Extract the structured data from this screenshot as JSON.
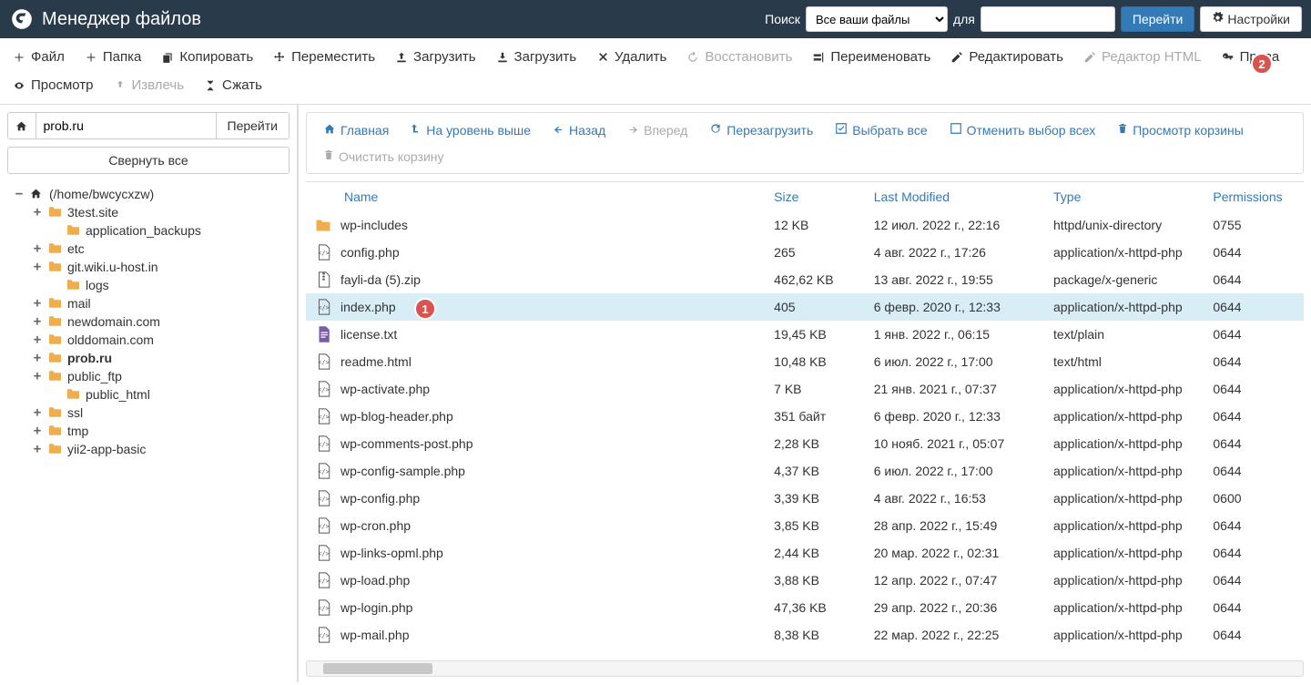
{
  "header": {
    "title": "Менеджер файлов",
    "search_label": "Поиск",
    "for_label": "для",
    "go_btn": "Перейти",
    "settings_btn": "Настройки",
    "search_scope": "Все ваши файлы"
  },
  "toolbar": [
    {
      "id": "file",
      "label": "Файл",
      "icon": "plus",
      "disabled": false
    },
    {
      "id": "folder",
      "label": "Папка",
      "icon": "plus",
      "disabled": false
    },
    {
      "id": "copy",
      "label": "Копировать",
      "icon": "copy",
      "disabled": false
    },
    {
      "id": "move",
      "label": "Переместить",
      "icon": "move",
      "disabled": false
    },
    {
      "id": "upload",
      "label": "Загрузить",
      "icon": "upload",
      "disabled": false
    },
    {
      "id": "download",
      "label": "Загрузить",
      "icon": "download",
      "disabled": false
    },
    {
      "id": "delete",
      "label": "Удалить",
      "icon": "delete",
      "disabled": false
    },
    {
      "id": "restore",
      "label": "Восстановить",
      "icon": "restore",
      "disabled": true
    },
    {
      "id": "rename",
      "label": "Переименовать",
      "icon": "rename",
      "disabled": false
    },
    {
      "id": "edit",
      "label": "Редактировать",
      "icon": "edit",
      "disabled": false
    },
    {
      "id": "htmleditor",
      "label": "Редактор HTML",
      "icon": "html",
      "disabled": true
    },
    {
      "id": "perms",
      "label": "Права",
      "icon": "key",
      "disabled": false
    },
    {
      "id": "view",
      "label": "Просмотр",
      "icon": "eye",
      "disabled": false
    },
    {
      "id": "extract",
      "label": "Извлечь",
      "icon": "extract",
      "disabled": true
    },
    {
      "id": "compress",
      "label": "Сжать",
      "icon": "compress",
      "disabled": false
    }
  ],
  "sidebar": {
    "path_value": "prob.ru",
    "go_btn": "Перейти",
    "collapse_btn": "Свернуть все",
    "root_label": "(/home/bwcycxzw)",
    "tree": [
      {
        "label": "3test.site",
        "exp": "+",
        "children": [
          {
            "label": "application_backups",
            "exp": ""
          }
        ]
      },
      {
        "label": "etc",
        "exp": "+"
      },
      {
        "label": "git.wiki.u-host.in",
        "exp": "+",
        "children": [
          {
            "label": "logs",
            "exp": ""
          }
        ]
      },
      {
        "label": "mail",
        "exp": "+"
      },
      {
        "label": "newdomain.com",
        "exp": "+"
      },
      {
        "label": "olddomain.com",
        "exp": "+"
      },
      {
        "label": "prob.ru",
        "exp": "+",
        "bold": true
      },
      {
        "label": "public_ftp",
        "exp": "+",
        "children": [
          {
            "label": "public_html",
            "exp": ""
          }
        ]
      },
      {
        "label": "ssl",
        "exp": "+"
      },
      {
        "label": "tmp",
        "exp": "+"
      },
      {
        "label": "yii2-app-basic",
        "exp": "+"
      }
    ]
  },
  "nav": [
    {
      "id": "home",
      "label": "Главная",
      "icon": "home",
      "disabled": false
    },
    {
      "id": "up",
      "label": "На уровень выше",
      "icon": "levelup",
      "disabled": false
    },
    {
      "id": "back",
      "label": "Назад",
      "icon": "back",
      "disabled": false
    },
    {
      "id": "forward",
      "label": "Вперед",
      "icon": "forward",
      "disabled": true
    },
    {
      "id": "reload",
      "label": "Перезагрузить",
      "icon": "reload",
      "disabled": false
    },
    {
      "id": "selectall",
      "label": "Выбрать все",
      "icon": "check",
      "disabled": false
    },
    {
      "id": "deselect",
      "label": "Отменить выбор всех",
      "icon": "uncheck",
      "disabled": false
    },
    {
      "id": "viewtrash",
      "label": "Просмотр корзины",
      "icon": "trash",
      "disabled": false
    },
    {
      "id": "emptytrash",
      "label": "Очистить корзину",
      "icon": "trash",
      "disabled": true
    }
  ],
  "columns": {
    "name": "Name",
    "size": "Size",
    "modified": "Last Modified",
    "type": "Type",
    "perms": "Permissions"
  },
  "files": [
    {
      "name": "wp-includes",
      "size": "12 KB",
      "modified": "12 июл. 2022 г., 22:16",
      "type": "httpd/unix-directory",
      "perms": "0755",
      "ftype": "folder"
    },
    {
      "name": "config.php",
      "size": "265",
      "modified": "4 авг. 2022 г., 17:26",
      "type": "application/x-httpd-php",
      "perms": "0644",
      "ftype": "php"
    },
    {
      "name": "fayli-da (5).zip",
      "size": "462,62 KB",
      "modified": "13 авг. 2022 г., 19:55",
      "type": "package/x-generic",
      "perms": "0644",
      "ftype": "zip"
    },
    {
      "name": "index.php",
      "size": "405",
      "modified": "6 февр. 2020 г., 12:33",
      "type": "application/x-httpd-php",
      "perms": "0644",
      "ftype": "php",
      "selected": true
    },
    {
      "name": "license.txt",
      "size": "19,45 KB",
      "modified": "1 янв. 2022 г., 06:15",
      "type": "text/plain",
      "perms": "0644",
      "ftype": "txt"
    },
    {
      "name": "readme.html",
      "size": "10,48 KB",
      "modified": "6 июл. 2022 г., 17:00",
      "type": "text/html",
      "perms": "0644",
      "ftype": "php"
    },
    {
      "name": "wp-activate.php",
      "size": "7 KB",
      "modified": "21 янв. 2021 г., 07:37",
      "type": "application/x-httpd-php",
      "perms": "0644",
      "ftype": "php"
    },
    {
      "name": "wp-blog-header.php",
      "size": "351 байт",
      "modified": "6 февр. 2020 г., 12:33",
      "type": "application/x-httpd-php",
      "perms": "0644",
      "ftype": "php"
    },
    {
      "name": "wp-comments-post.php",
      "size": "2,28 KB",
      "modified": "10 нояб. 2021 г., 05:07",
      "type": "application/x-httpd-php",
      "perms": "0644",
      "ftype": "php"
    },
    {
      "name": "wp-config-sample.php",
      "size": "4,37 KB",
      "modified": "6 июл. 2022 г., 17:00",
      "type": "application/x-httpd-php",
      "perms": "0644",
      "ftype": "php"
    },
    {
      "name": "wp-config.php",
      "size": "3,39 KB",
      "modified": "4 авг. 2022 г., 16:53",
      "type": "application/x-httpd-php",
      "perms": "0600",
      "ftype": "php"
    },
    {
      "name": "wp-cron.php",
      "size": "3,85 KB",
      "modified": "28 апр. 2022 г., 15:49",
      "type": "application/x-httpd-php",
      "perms": "0644",
      "ftype": "php"
    },
    {
      "name": "wp-links-opml.php",
      "size": "2,44 KB",
      "modified": "20 мар. 2022 г., 02:31",
      "type": "application/x-httpd-php",
      "perms": "0644",
      "ftype": "php"
    },
    {
      "name": "wp-load.php",
      "size": "3,88 KB",
      "modified": "12 апр. 2022 г., 07:47",
      "type": "application/x-httpd-php",
      "perms": "0644",
      "ftype": "php"
    },
    {
      "name": "wp-login.php",
      "size": "47,36 KB",
      "modified": "29 апр. 2022 г., 20:36",
      "type": "application/x-httpd-php",
      "perms": "0644",
      "ftype": "php"
    },
    {
      "name": "wp-mail.php",
      "size": "8,38 KB",
      "modified": "22 мар. 2022 г., 22:25",
      "type": "application/x-httpd-php",
      "perms": "0644",
      "ftype": "php"
    }
  ],
  "badges": {
    "b1": "1",
    "b2": "2"
  }
}
